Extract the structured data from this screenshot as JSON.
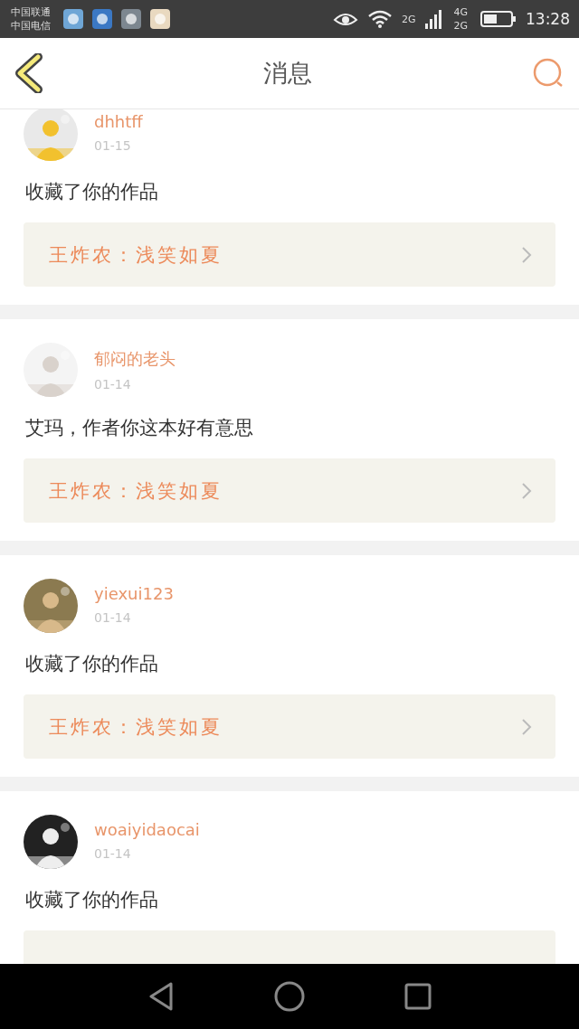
{
  "status_bar": {
    "carriers": [
      "中国联通",
      "中国电信"
    ],
    "signal_label": "2G",
    "dual_labels": [
      "4G",
      "2G"
    ],
    "time": "13:28"
  },
  "header": {
    "title": "消息"
  },
  "messages": [
    {
      "user": "dhhtff",
      "date": "01-15",
      "text": "收藏了你的作品",
      "card": "王炸农：浅笑如夏"
    },
    {
      "user": "郁闷的老头",
      "date": "01-14",
      "text": "艾玛，作者你这本好有意思",
      "card": "王炸农：浅笑如夏"
    },
    {
      "user": "yiexui123",
      "date": "01-14",
      "text": "收藏了你的作品",
      "card": "王炸农：浅笑如夏"
    },
    {
      "user": "woaiyidaocai",
      "date": "01-14",
      "text": "收藏了你的作品"
    }
  ]
}
